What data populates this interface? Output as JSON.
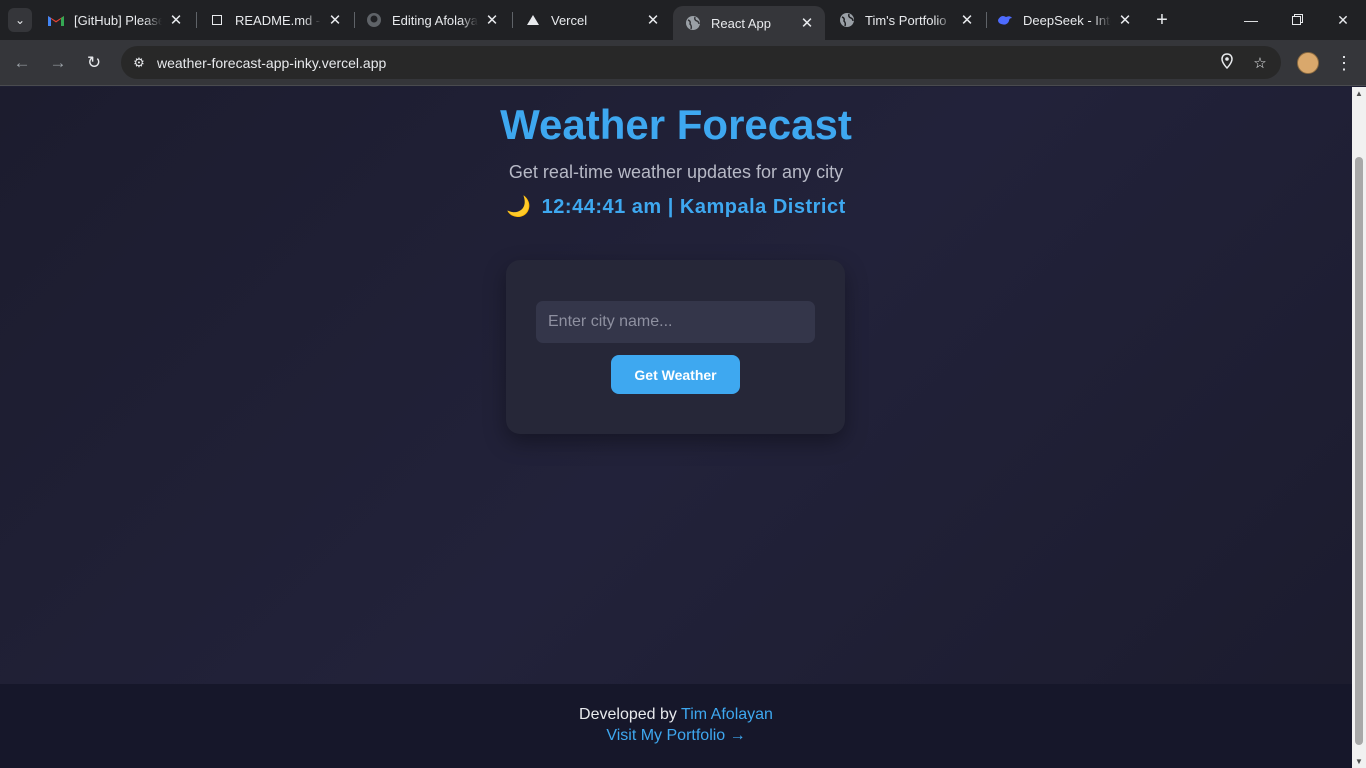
{
  "browser": {
    "tabs": [
      {
        "title": "[GitHub] Please verify",
        "favicon": "gmail-icon"
      },
      {
        "title": "README.md - weather",
        "favicon": "file-icon"
      },
      {
        "title": "Editing Afolayan",
        "favicon": "github-icon"
      },
      {
        "title": "Vercel",
        "favicon": "vercel-icon"
      },
      {
        "title": "React App",
        "favicon": "globe-icon",
        "active": true
      },
      {
        "title": "Tim's Portfolio",
        "favicon": "globe-icon"
      },
      {
        "title": "DeepSeek - Into",
        "favicon": "deepseek-icon"
      }
    ],
    "url": "weather-forecast-app-inky.vercel.app"
  },
  "app": {
    "title": "Weather Forecast",
    "subtitle": "Get real-time weather updates for any city",
    "time_location": "12:44:41 am | Kampala District",
    "moon_glyph": "🌙",
    "search": {
      "placeholder": "Enter city name...",
      "value": ""
    },
    "button_label": "Get Weather",
    "accent_color": "#3ea8f0"
  },
  "footer": {
    "developed_by": "Developed by",
    "developer_name": "Tim Afolayan",
    "portfolio_link": "Visit My Portfolio →"
  }
}
